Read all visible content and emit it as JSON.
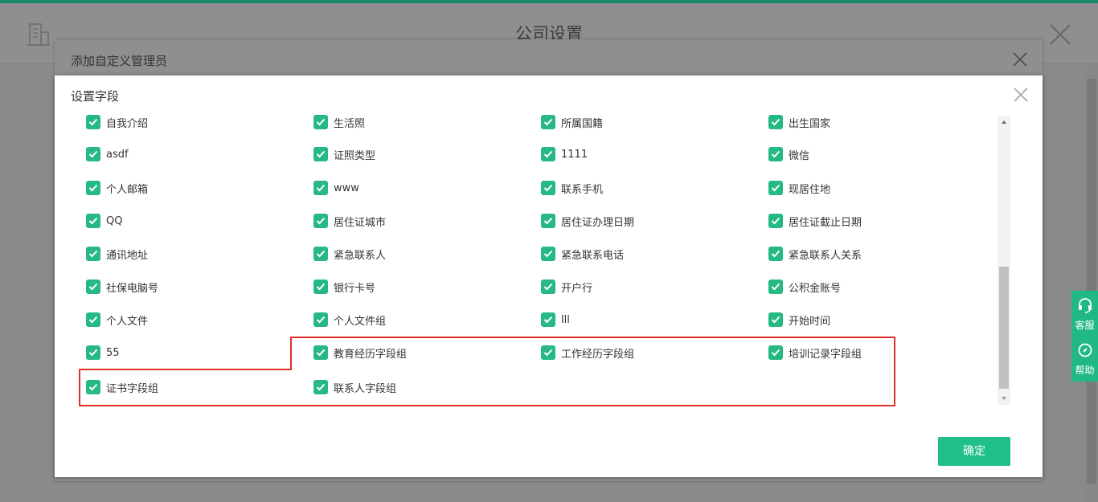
{
  "page": {
    "title": "公司设置",
    "icons": {
      "left": "building-icon",
      "right": "close-icon"
    }
  },
  "back_dialog": {
    "title": "添加自定义管理员"
  },
  "dialog": {
    "title": "设置字段",
    "ok_label": "确定",
    "fields": [
      [
        "自我介绍",
        "生活照",
        "所属国籍",
        "出生国家"
      ],
      [
        "asdf",
        "证照类型",
        "1111",
        "微信"
      ],
      [
        "个人邮箱",
        "www",
        "联系手机",
        "现居住地"
      ],
      [
        "QQ",
        "居住证城市",
        "居住证办理日期",
        "居住证截止日期"
      ],
      [
        "通讯地址",
        "紧急联系人",
        "紧急联系电话",
        "紧急联系人关系"
      ],
      [
        "社保电脑号",
        "银行卡号",
        "开户行",
        "公积金账号"
      ],
      [
        "个人文件",
        "个人文件组",
        "lll",
        "开始时间"
      ],
      [
        "55",
        "教育经历字段组",
        "工作经历字段组",
        "培训记录字段组"
      ],
      [
        "证书字段组",
        "联系人字段组"
      ]
    ],
    "all_checked": true
  },
  "side_widget": {
    "service_label": "客服",
    "help_label": "帮助"
  },
  "colors": {
    "accent": "#26b984",
    "button": "#1fbf8a",
    "highlight": "#e0302a",
    "overlay": "#8c8c8c"
  }
}
